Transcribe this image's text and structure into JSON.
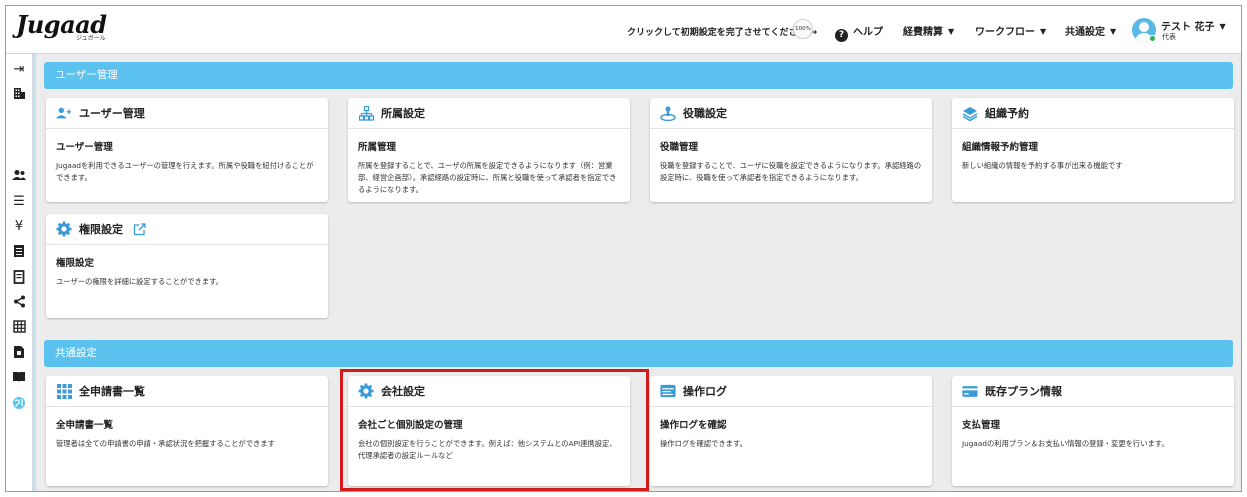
{
  "header": {
    "logo": "Jugaad",
    "logo_sub": "ジュガール",
    "setup_prompt": "クリックして初期設定を完了させてください →",
    "setup_progress": "100%",
    "nav": [
      {
        "label": "ヘルプ",
        "icon": "help-icon"
      },
      {
        "label": "経費精算",
        "icon": "caret-down-icon"
      },
      {
        "label": "ワークフロー",
        "icon": "caret-down-icon"
      },
      {
        "label": "共通設定",
        "icon": "caret-down-icon"
      }
    ],
    "user": {
      "name": "テスト 花子",
      "role": "代表",
      "status_color": "#2fb34a"
    }
  },
  "sidebar": {
    "icons": [
      "collapse-menu-icon",
      "building-icon",
      "users-icon",
      "list-icon",
      "yen-icon",
      "document-icon",
      "receipt-icon",
      "share-icon",
      "grid-icon",
      "file-icon",
      "book-icon",
      "globe-icon"
    ]
  },
  "sections": [
    {
      "title": "ユーザー管理",
      "cards": [
        {
          "title": "ユーザー管理",
          "icon": "user-add-icon",
          "subtitle": "ユーザー管理",
          "description": "Jugaadを利用できるユーザーの管理を行えます。所属や役職を紐付けることができます。"
        },
        {
          "title": "所属設定",
          "icon": "org-chart-icon",
          "subtitle": "所属管理",
          "description": "所属を登録することで、ユーザの所属を設定できるようになります（例：営業部、経営企画部）。承認経路の設定時に、所属と役職を使って承認者を指定できるようになります。"
        },
        {
          "title": "役職設定",
          "icon": "position-icon",
          "subtitle": "役職管理",
          "description": "役職を登録することで、ユーザに役職を設定できるようになります。承認経路の設定時に、役職を使って承認者を指定できるようになります。"
        },
        {
          "title": "組織予約",
          "icon": "layers-icon",
          "subtitle": "組織情報予約管理",
          "description": "新しい組織の情報を予約する事が出来る機能です"
        },
        {
          "title": "権限設定",
          "icon": "gear-icon",
          "subtitle": "権限設定",
          "description": "ユーザーの権限を詳細に設定することができます。",
          "external_icon": "external-link-icon"
        }
      ]
    },
    {
      "title": "共通設定",
      "cards": [
        {
          "title": "全申請書一覧",
          "icon": "grid-dots-icon",
          "subtitle": "全申請書一覧",
          "description": "管理者は全ての申請書の申請・承認状況を把握することができます"
        },
        {
          "title": "会社設定",
          "icon": "gear-icon",
          "subtitle": "会社ごと個別設定の管理",
          "description": "会社の個別設定を行うことができます。例えば：他システムとのAPI連携設定、代理承認者の設定ルールなど"
        },
        {
          "title": "操作ログ",
          "icon": "log-icon",
          "subtitle": "操作ログを確認",
          "description": "操作ログを確認できます。"
        },
        {
          "title": "既存プラン情報",
          "icon": "credit-card-icon",
          "subtitle": "支払管理",
          "description": "Jugaadの利用プラン＆お支払い情報の登録・変更を行います。"
        }
      ]
    }
  ],
  "colors": {
    "accent": "#5bc2ef",
    "icon": "#3a9bd8",
    "highlight": "#d21c1c"
  }
}
